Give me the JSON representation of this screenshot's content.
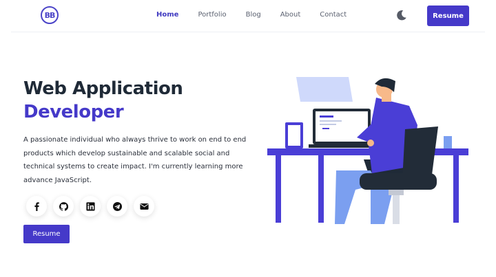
{
  "nav": {
    "logo_text": "BB",
    "items": [
      {
        "label": "Home",
        "active": true
      },
      {
        "label": "Portfolio",
        "active": false
      },
      {
        "label": "Blog",
        "active": false
      },
      {
        "label": "About",
        "active": false
      },
      {
        "label": "Contact",
        "active": false
      }
    ],
    "theme_icon": "moon-icon",
    "resume_label": "Resume"
  },
  "hero": {
    "title_line1": "Web Application",
    "title_line2": "Developer",
    "description": "A passionate individual who always thrive to work on end to end products which develop sustainable and scalable social and technical systems to create impact. I'm currently learning more advance JavaScript.",
    "socials": [
      "facebook-icon",
      "github-icon",
      "linkedin-icon",
      "telegram-icon",
      "email-icon"
    ],
    "resume_label": "Resume"
  },
  "colors": {
    "accent": "#4539c9",
    "heading": "#1f2a37",
    "text": "#2a2f3a"
  }
}
